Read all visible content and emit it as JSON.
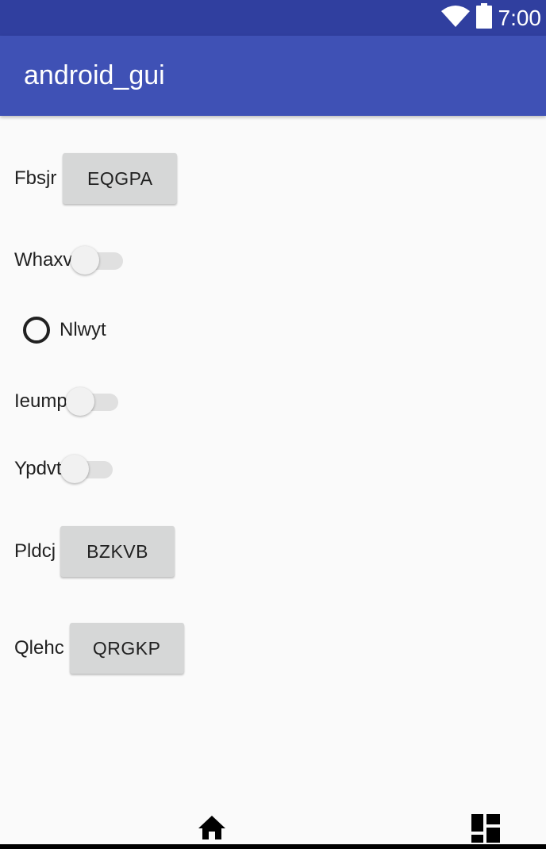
{
  "status_bar": {
    "time": "7:00",
    "icons": [
      "wifi-icon",
      "battery-icon"
    ]
  },
  "app_bar": {
    "title": "android_gui"
  },
  "rows": {
    "row1": {
      "label": "Fbsjr",
      "button": "EQGPA"
    },
    "row2": {
      "label": "Whaxv",
      "switch_on": false
    },
    "row3": {
      "radio_label": "Nlwyt",
      "checked": false
    },
    "row4": {
      "label": "Ieump",
      "switch_on": false
    },
    "row5": {
      "label": "Ypdvt",
      "switch_on": false
    },
    "row6": {
      "label": "Pldcj",
      "button": "BZKVB"
    },
    "row7": {
      "label": "Qlehc",
      "button": "QRGKP"
    }
  },
  "nav_bar": {
    "icons": [
      "home-icon",
      "recents-icon"
    ]
  },
  "colors": {
    "status_bar": "#303f9f",
    "app_bar": "#3f51b5",
    "background": "#fafafa",
    "button": "#d6d7d7"
  }
}
